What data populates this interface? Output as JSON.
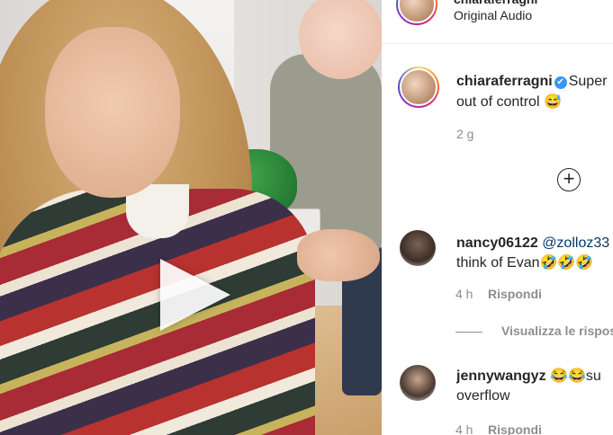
{
  "post": {
    "top_username": "chiaraferragni",
    "audio_label": "Original Audio"
  },
  "caption": {
    "username": "chiaraferragni",
    "verified_icon": "✔",
    "text_line1": "Super",
    "text_line2": "out of control 😅",
    "time": "2 g"
  },
  "add_icon": "+",
  "comments": [
    {
      "username": "nancy06122",
      "mention": "@zolloz33",
      "text_line2": "think of Evan🤣🤣🤣",
      "time": "4 h",
      "reply_label": "Rispondi"
    },
    {
      "username": "jennywangyz",
      "text_line1": "😂😂su",
      "text_line2": "overflow",
      "time": "4 h",
      "reply_label": "Rispondi"
    }
  ],
  "view_replies_label": "Visualizza le risposte",
  "icons": {
    "play": "play-icon",
    "verified": "verified-badge-icon",
    "add": "add-circle-icon"
  },
  "colors": {
    "verified_blue": "#3897f0",
    "mention_blue": "#00376b",
    "secondary_gray": "#8e8e8e"
  }
}
